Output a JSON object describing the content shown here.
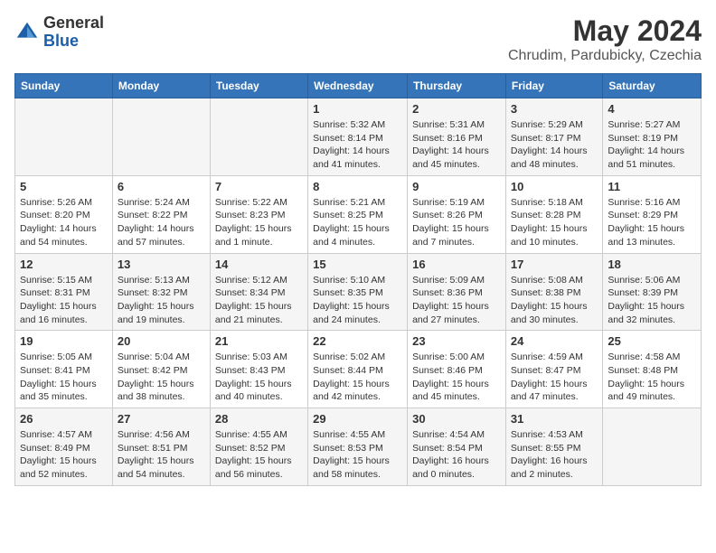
{
  "logo": {
    "general": "General",
    "blue": "Blue"
  },
  "title": "May 2024",
  "subtitle": "Chrudim, Pardubicky, Czechia",
  "days_of_week": [
    "Sunday",
    "Monday",
    "Tuesday",
    "Wednesday",
    "Thursday",
    "Friday",
    "Saturday"
  ],
  "weeks": [
    [
      {
        "day": "",
        "info": ""
      },
      {
        "day": "",
        "info": ""
      },
      {
        "day": "",
        "info": ""
      },
      {
        "day": "1",
        "info": "Sunrise: 5:32 AM\nSunset: 8:14 PM\nDaylight: 14 hours\nand 41 minutes."
      },
      {
        "day": "2",
        "info": "Sunrise: 5:31 AM\nSunset: 8:16 PM\nDaylight: 14 hours\nand 45 minutes."
      },
      {
        "day": "3",
        "info": "Sunrise: 5:29 AM\nSunset: 8:17 PM\nDaylight: 14 hours\nand 48 minutes."
      },
      {
        "day": "4",
        "info": "Sunrise: 5:27 AM\nSunset: 8:19 PM\nDaylight: 14 hours\nand 51 minutes."
      }
    ],
    [
      {
        "day": "5",
        "info": "Sunrise: 5:26 AM\nSunset: 8:20 PM\nDaylight: 14 hours\nand 54 minutes."
      },
      {
        "day": "6",
        "info": "Sunrise: 5:24 AM\nSunset: 8:22 PM\nDaylight: 14 hours\nand 57 minutes."
      },
      {
        "day": "7",
        "info": "Sunrise: 5:22 AM\nSunset: 8:23 PM\nDaylight: 15 hours\nand 1 minute."
      },
      {
        "day": "8",
        "info": "Sunrise: 5:21 AM\nSunset: 8:25 PM\nDaylight: 15 hours\nand 4 minutes."
      },
      {
        "day": "9",
        "info": "Sunrise: 5:19 AM\nSunset: 8:26 PM\nDaylight: 15 hours\nand 7 minutes."
      },
      {
        "day": "10",
        "info": "Sunrise: 5:18 AM\nSunset: 8:28 PM\nDaylight: 15 hours\nand 10 minutes."
      },
      {
        "day": "11",
        "info": "Sunrise: 5:16 AM\nSunset: 8:29 PM\nDaylight: 15 hours\nand 13 minutes."
      }
    ],
    [
      {
        "day": "12",
        "info": "Sunrise: 5:15 AM\nSunset: 8:31 PM\nDaylight: 15 hours\nand 16 minutes."
      },
      {
        "day": "13",
        "info": "Sunrise: 5:13 AM\nSunset: 8:32 PM\nDaylight: 15 hours\nand 19 minutes."
      },
      {
        "day": "14",
        "info": "Sunrise: 5:12 AM\nSunset: 8:34 PM\nDaylight: 15 hours\nand 21 minutes."
      },
      {
        "day": "15",
        "info": "Sunrise: 5:10 AM\nSunset: 8:35 PM\nDaylight: 15 hours\nand 24 minutes."
      },
      {
        "day": "16",
        "info": "Sunrise: 5:09 AM\nSunset: 8:36 PM\nDaylight: 15 hours\nand 27 minutes."
      },
      {
        "day": "17",
        "info": "Sunrise: 5:08 AM\nSunset: 8:38 PM\nDaylight: 15 hours\nand 30 minutes."
      },
      {
        "day": "18",
        "info": "Sunrise: 5:06 AM\nSunset: 8:39 PM\nDaylight: 15 hours\nand 32 minutes."
      }
    ],
    [
      {
        "day": "19",
        "info": "Sunrise: 5:05 AM\nSunset: 8:41 PM\nDaylight: 15 hours\nand 35 minutes."
      },
      {
        "day": "20",
        "info": "Sunrise: 5:04 AM\nSunset: 8:42 PM\nDaylight: 15 hours\nand 38 minutes."
      },
      {
        "day": "21",
        "info": "Sunrise: 5:03 AM\nSunset: 8:43 PM\nDaylight: 15 hours\nand 40 minutes."
      },
      {
        "day": "22",
        "info": "Sunrise: 5:02 AM\nSunset: 8:44 PM\nDaylight: 15 hours\nand 42 minutes."
      },
      {
        "day": "23",
        "info": "Sunrise: 5:00 AM\nSunset: 8:46 PM\nDaylight: 15 hours\nand 45 minutes."
      },
      {
        "day": "24",
        "info": "Sunrise: 4:59 AM\nSunset: 8:47 PM\nDaylight: 15 hours\nand 47 minutes."
      },
      {
        "day": "25",
        "info": "Sunrise: 4:58 AM\nSunset: 8:48 PM\nDaylight: 15 hours\nand 49 minutes."
      }
    ],
    [
      {
        "day": "26",
        "info": "Sunrise: 4:57 AM\nSunset: 8:49 PM\nDaylight: 15 hours\nand 52 minutes."
      },
      {
        "day": "27",
        "info": "Sunrise: 4:56 AM\nSunset: 8:51 PM\nDaylight: 15 hours\nand 54 minutes."
      },
      {
        "day": "28",
        "info": "Sunrise: 4:55 AM\nSunset: 8:52 PM\nDaylight: 15 hours\nand 56 minutes."
      },
      {
        "day": "29",
        "info": "Sunrise: 4:55 AM\nSunset: 8:53 PM\nDaylight: 15 hours\nand 58 minutes."
      },
      {
        "day": "30",
        "info": "Sunrise: 4:54 AM\nSunset: 8:54 PM\nDaylight: 16 hours\nand 0 minutes."
      },
      {
        "day": "31",
        "info": "Sunrise: 4:53 AM\nSunset: 8:55 PM\nDaylight: 16 hours\nand 2 minutes."
      },
      {
        "day": "",
        "info": ""
      }
    ]
  ]
}
